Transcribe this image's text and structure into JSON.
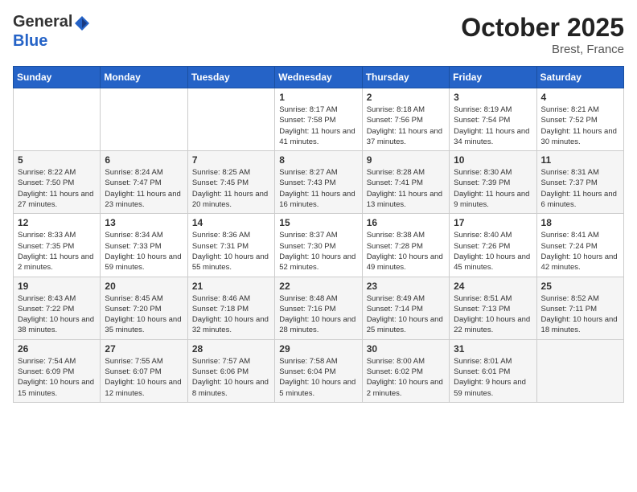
{
  "header": {
    "logo_general": "General",
    "logo_blue": "Blue",
    "month": "October 2025",
    "location": "Brest, France"
  },
  "weekdays": [
    "Sunday",
    "Monday",
    "Tuesday",
    "Wednesday",
    "Thursday",
    "Friday",
    "Saturday"
  ],
  "weeks": [
    [
      {
        "day": "",
        "info": ""
      },
      {
        "day": "",
        "info": ""
      },
      {
        "day": "",
        "info": ""
      },
      {
        "day": "1",
        "info": "Sunrise: 8:17 AM\nSunset: 7:58 PM\nDaylight: 11 hours and 41 minutes."
      },
      {
        "day": "2",
        "info": "Sunrise: 8:18 AM\nSunset: 7:56 PM\nDaylight: 11 hours and 37 minutes."
      },
      {
        "day": "3",
        "info": "Sunrise: 8:19 AM\nSunset: 7:54 PM\nDaylight: 11 hours and 34 minutes."
      },
      {
        "day": "4",
        "info": "Sunrise: 8:21 AM\nSunset: 7:52 PM\nDaylight: 11 hours and 30 minutes."
      }
    ],
    [
      {
        "day": "5",
        "info": "Sunrise: 8:22 AM\nSunset: 7:50 PM\nDaylight: 11 hours and 27 minutes."
      },
      {
        "day": "6",
        "info": "Sunrise: 8:24 AM\nSunset: 7:47 PM\nDaylight: 11 hours and 23 minutes."
      },
      {
        "day": "7",
        "info": "Sunrise: 8:25 AM\nSunset: 7:45 PM\nDaylight: 11 hours and 20 minutes."
      },
      {
        "day": "8",
        "info": "Sunrise: 8:27 AM\nSunset: 7:43 PM\nDaylight: 11 hours and 16 minutes."
      },
      {
        "day": "9",
        "info": "Sunrise: 8:28 AM\nSunset: 7:41 PM\nDaylight: 11 hours and 13 minutes."
      },
      {
        "day": "10",
        "info": "Sunrise: 8:30 AM\nSunset: 7:39 PM\nDaylight: 11 hours and 9 minutes."
      },
      {
        "day": "11",
        "info": "Sunrise: 8:31 AM\nSunset: 7:37 PM\nDaylight: 11 hours and 6 minutes."
      }
    ],
    [
      {
        "day": "12",
        "info": "Sunrise: 8:33 AM\nSunset: 7:35 PM\nDaylight: 11 hours and 2 minutes."
      },
      {
        "day": "13",
        "info": "Sunrise: 8:34 AM\nSunset: 7:33 PM\nDaylight: 10 hours and 59 minutes."
      },
      {
        "day": "14",
        "info": "Sunrise: 8:36 AM\nSunset: 7:31 PM\nDaylight: 10 hours and 55 minutes."
      },
      {
        "day": "15",
        "info": "Sunrise: 8:37 AM\nSunset: 7:30 PM\nDaylight: 10 hours and 52 minutes."
      },
      {
        "day": "16",
        "info": "Sunrise: 8:38 AM\nSunset: 7:28 PM\nDaylight: 10 hours and 49 minutes."
      },
      {
        "day": "17",
        "info": "Sunrise: 8:40 AM\nSunset: 7:26 PM\nDaylight: 10 hours and 45 minutes."
      },
      {
        "day": "18",
        "info": "Sunrise: 8:41 AM\nSunset: 7:24 PM\nDaylight: 10 hours and 42 minutes."
      }
    ],
    [
      {
        "day": "19",
        "info": "Sunrise: 8:43 AM\nSunset: 7:22 PM\nDaylight: 10 hours and 38 minutes."
      },
      {
        "day": "20",
        "info": "Sunrise: 8:45 AM\nSunset: 7:20 PM\nDaylight: 10 hours and 35 minutes."
      },
      {
        "day": "21",
        "info": "Sunrise: 8:46 AM\nSunset: 7:18 PM\nDaylight: 10 hours and 32 minutes."
      },
      {
        "day": "22",
        "info": "Sunrise: 8:48 AM\nSunset: 7:16 PM\nDaylight: 10 hours and 28 minutes."
      },
      {
        "day": "23",
        "info": "Sunrise: 8:49 AM\nSunset: 7:14 PM\nDaylight: 10 hours and 25 minutes."
      },
      {
        "day": "24",
        "info": "Sunrise: 8:51 AM\nSunset: 7:13 PM\nDaylight: 10 hours and 22 minutes."
      },
      {
        "day": "25",
        "info": "Sunrise: 8:52 AM\nSunset: 7:11 PM\nDaylight: 10 hours and 18 minutes."
      }
    ],
    [
      {
        "day": "26",
        "info": "Sunrise: 7:54 AM\nSunset: 6:09 PM\nDaylight: 10 hours and 15 minutes."
      },
      {
        "day": "27",
        "info": "Sunrise: 7:55 AM\nSunset: 6:07 PM\nDaylight: 10 hours and 12 minutes."
      },
      {
        "day": "28",
        "info": "Sunrise: 7:57 AM\nSunset: 6:06 PM\nDaylight: 10 hours and 8 minutes."
      },
      {
        "day": "29",
        "info": "Sunrise: 7:58 AM\nSunset: 6:04 PM\nDaylight: 10 hours and 5 minutes."
      },
      {
        "day": "30",
        "info": "Sunrise: 8:00 AM\nSunset: 6:02 PM\nDaylight: 10 hours and 2 minutes."
      },
      {
        "day": "31",
        "info": "Sunrise: 8:01 AM\nSunset: 6:01 PM\nDaylight: 9 hours and 59 minutes."
      },
      {
        "day": "",
        "info": ""
      }
    ]
  ]
}
